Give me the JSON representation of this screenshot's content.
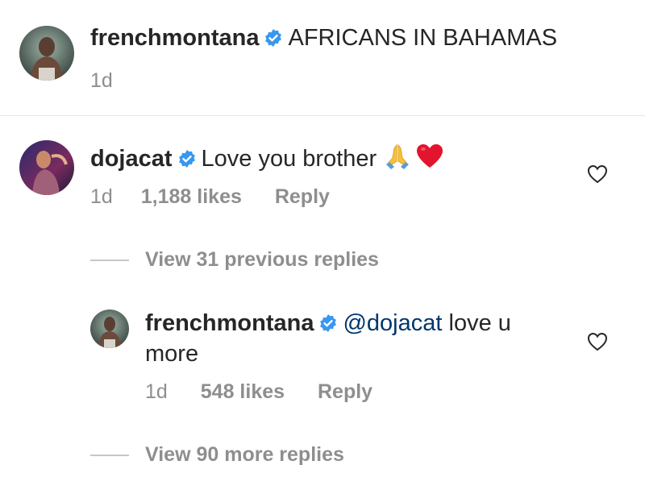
{
  "post": {
    "username": "frenchmontana",
    "caption": "AFRICANS IN BAHAMAS",
    "time": "1d"
  },
  "comment": {
    "username": "dojacat",
    "text": "Love you brother",
    "emojis": [
      "folded-hands",
      "red-heart"
    ],
    "time": "1d",
    "likes": "1,188 likes",
    "reply_label": "Reply",
    "view_previous": "View 31 previous replies"
  },
  "reply": {
    "username": "frenchmontana",
    "mention": "@dojacat",
    "text_line1": "love u",
    "text_line2": "more",
    "time": "1d",
    "likes": "548 likes",
    "reply_label": "Reply",
    "view_more": "View 90 more replies"
  },
  "colors": {
    "verified": "#3897f0",
    "mention": "#00376b",
    "muted": "#8e8e8e",
    "text": "#262626"
  }
}
